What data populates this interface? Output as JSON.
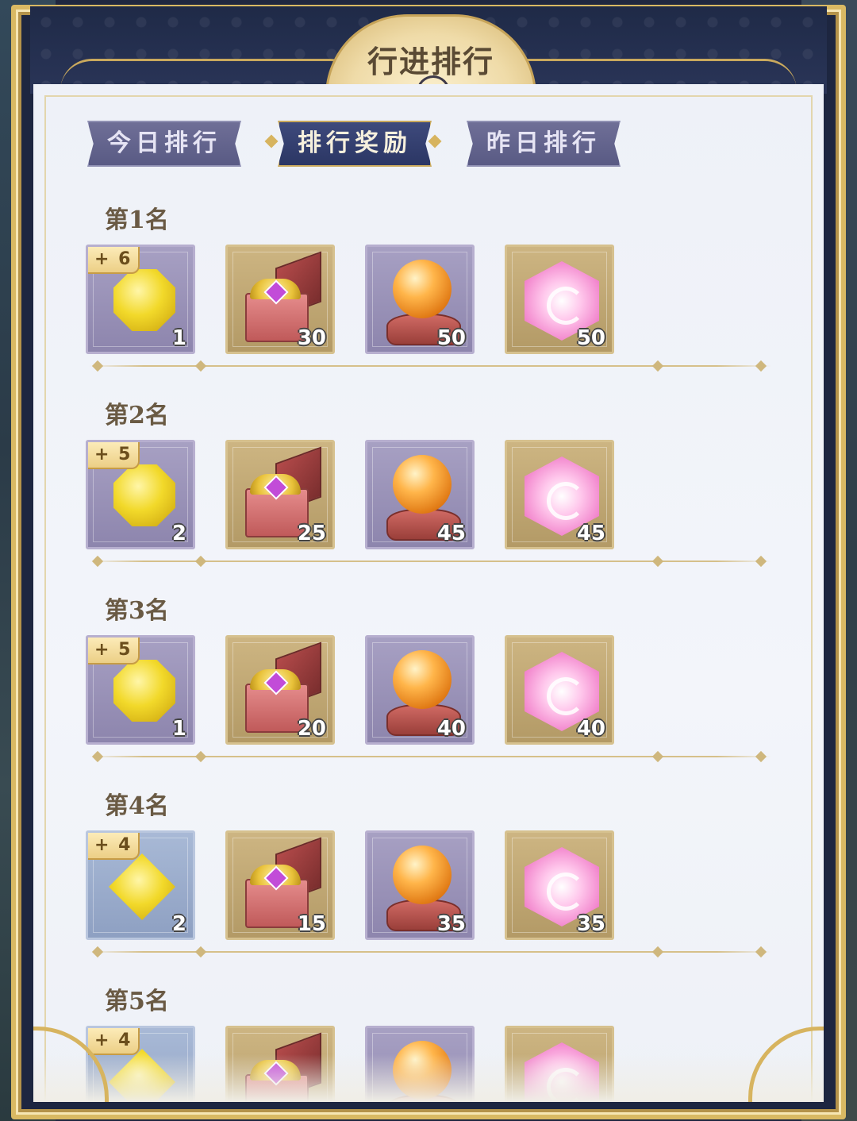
{
  "header": {
    "title": "行进排行"
  },
  "tabs": [
    {
      "label": "今日排行",
      "active": false
    },
    {
      "label": "排行奖励",
      "active": true
    },
    {
      "label": "昨日排行",
      "active": false
    }
  ],
  "ranks": [
    {
      "label": "第1名",
      "items": [
        {
          "icon": "yellow-gem-octagon-icon",
          "count": "1",
          "badge": "+ 6"
        },
        {
          "icon": "treasure-chest-icon",
          "count": "30"
        },
        {
          "icon": "orange-orb-icon",
          "count": "50"
        },
        {
          "icon": "pink-hex-crystal-icon",
          "count": "50"
        }
      ]
    },
    {
      "label": "第2名",
      "items": [
        {
          "icon": "yellow-gem-octagon-icon",
          "count": "2",
          "badge": "+ 5"
        },
        {
          "icon": "treasure-chest-icon",
          "count": "25"
        },
        {
          "icon": "orange-orb-icon",
          "count": "45"
        },
        {
          "icon": "pink-hex-crystal-icon",
          "count": "45"
        }
      ]
    },
    {
      "label": "第3名",
      "items": [
        {
          "icon": "yellow-gem-octagon-icon",
          "count": "1",
          "badge": "+ 5"
        },
        {
          "icon": "treasure-chest-icon",
          "count": "20"
        },
        {
          "icon": "orange-orb-icon",
          "count": "40"
        },
        {
          "icon": "pink-hex-crystal-icon",
          "count": "40"
        }
      ]
    },
    {
      "label": "第4名",
      "items": [
        {
          "icon": "yellow-gem-diamond-icon",
          "count": "2",
          "badge": "+ 4"
        },
        {
          "icon": "treasure-chest-icon",
          "count": "15"
        },
        {
          "icon": "orange-orb-icon",
          "count": "35"
        },
        {
          "icon": "pink-hex-crystal-icon",
          "count": "35"
        }
      ]
    },
    {
      "label": "第5名",
      "items": [
        {
          "icon": "yellow-gem-diamond-icon",
          "badge": "+ 4"
        },
        {
          "icon": "treasure-chest-icon"
        },
        {
          "icon": "orange-orb-icon"
        },
        {
          "icon": "pink-hex-crystal-icon"
        }
      ]
    }
  ],
  "colors": {
    "frame_gold": "#d9b963",
    "tab_active": "#2b3664",
    "tab_inactive": "#595a84",
    "rank_text": "#6a5a44"
  }
}
